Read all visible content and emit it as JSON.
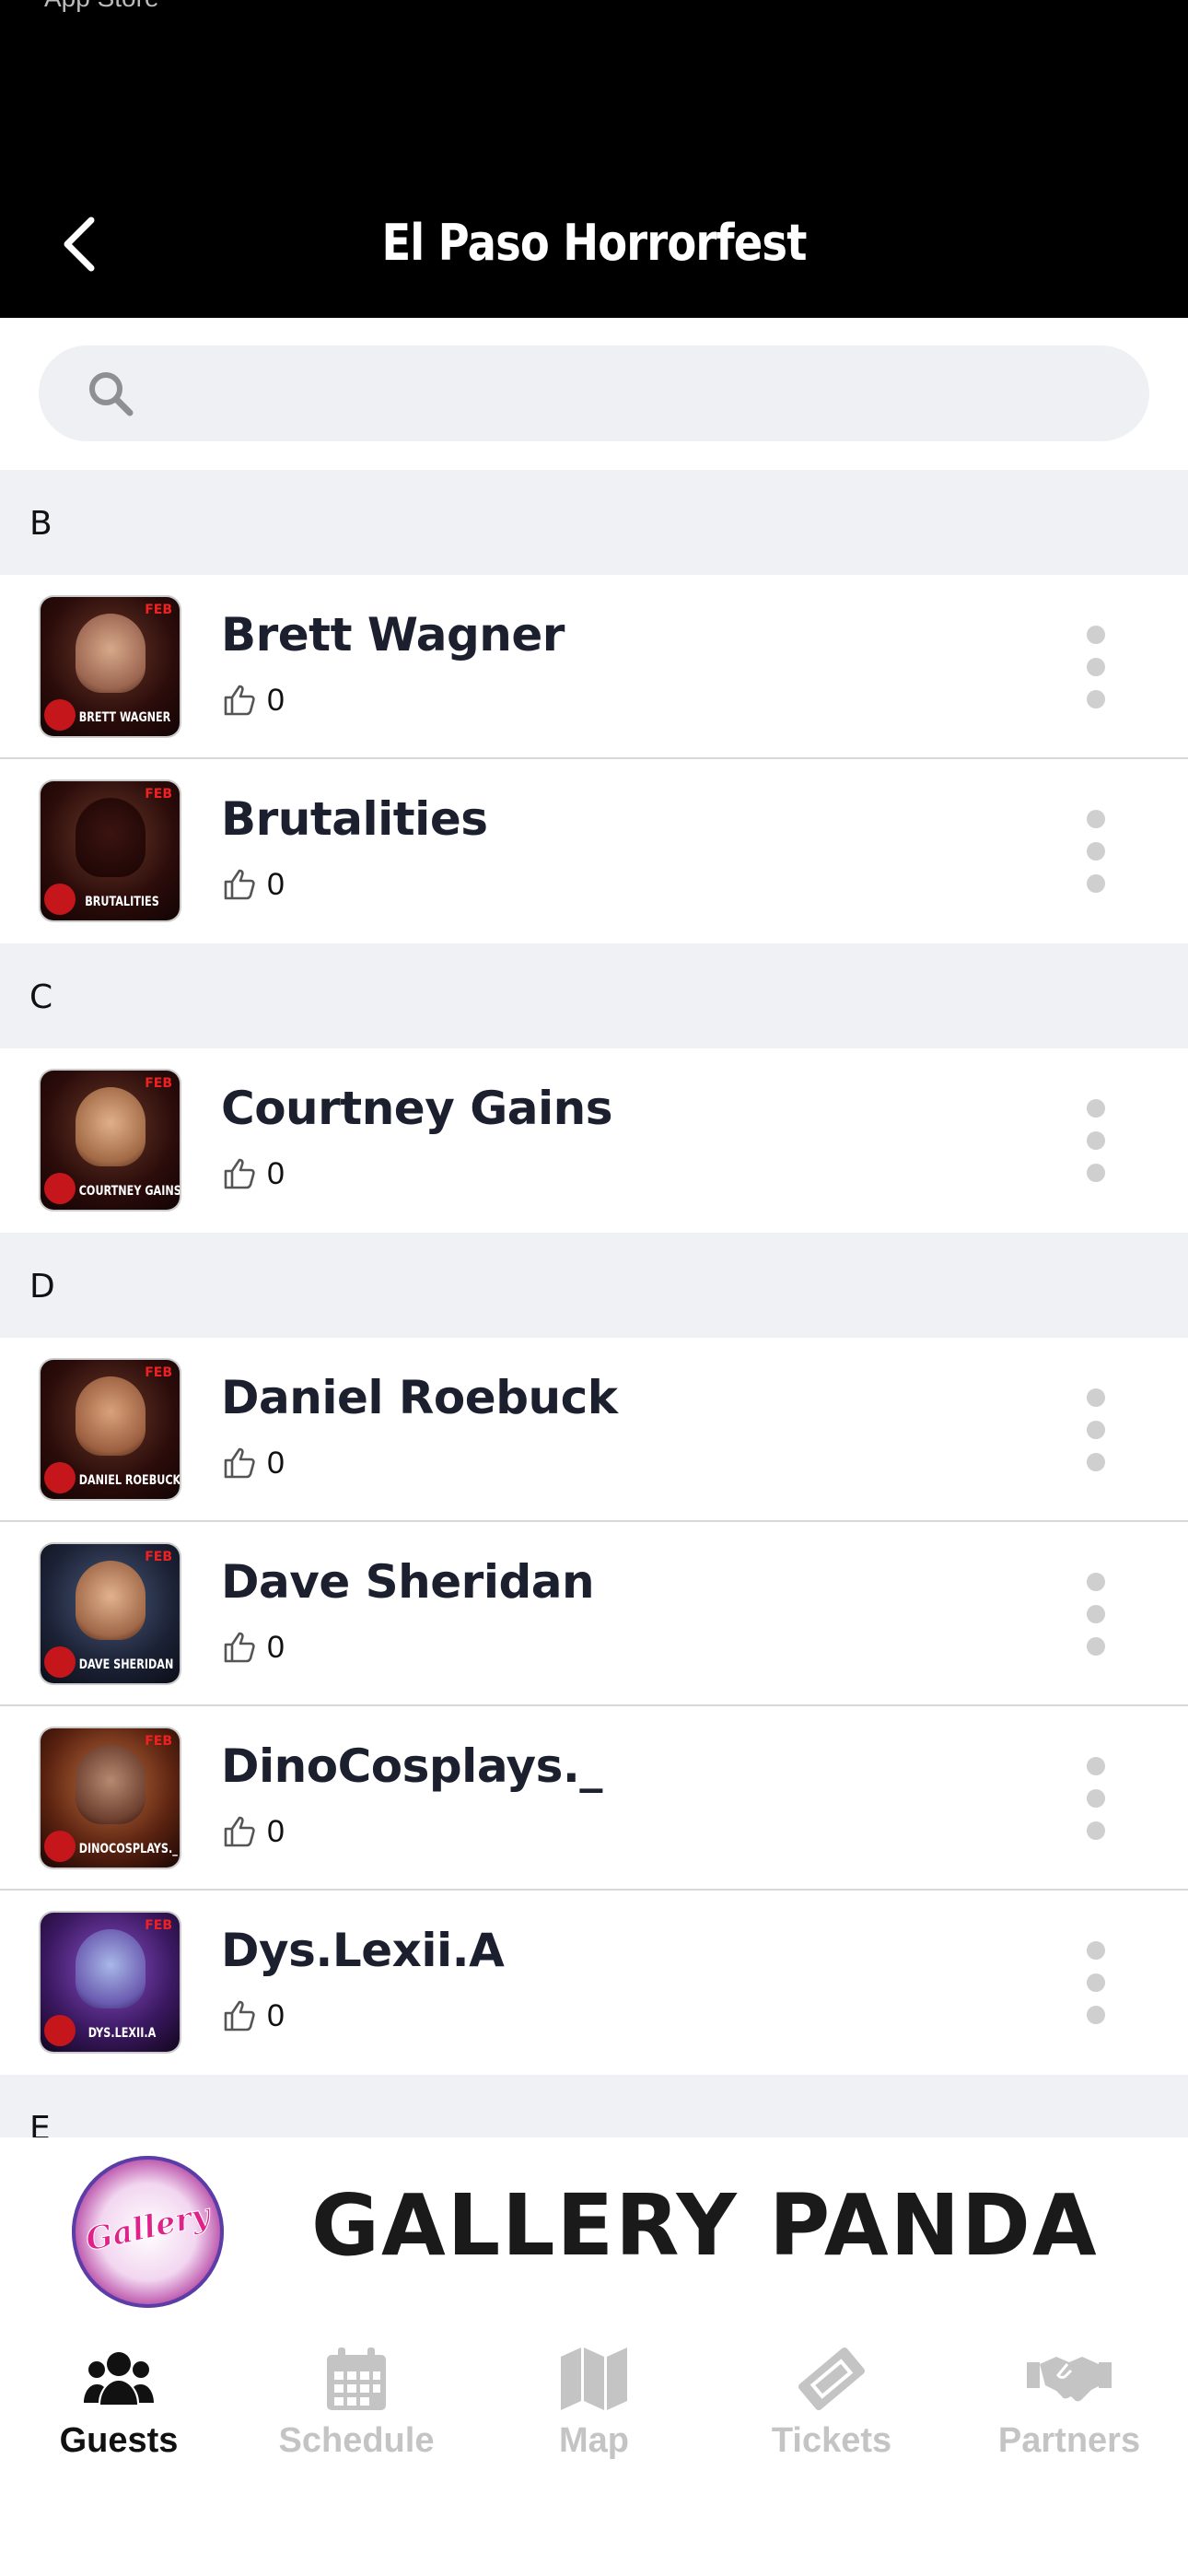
{
  "status_bar": {
    "text": "App Store"
  },
  "nav": {
    "title": "El Paso Horrorfest"
  },
  "search": {
    "placeholder": ""
  },
  "sections": [
    {
      "letter": "B",
      "guests": [
        {
          "name": "Brett Wagner",
          "likes": "0",
          "caption": "BRETT WAGNER"
        },
        {
          "name": "Brutalities",
          "likes": "0",
          "caption": "BRUTALITIES"
        }
      ]
    },
    {
      "letter": "C",
      "guests": [
        {
          "name": "Courtney Gains",
          "likes": "0",
          "caption": "COURTNEY GAINS"
        }
      ]
    },
    {
      "letter": "D",
      "guests": [
        {
          "name": "Daniel Roebuck",
          "likes": "0",
          "caption": "DANIEL ROEBUCK"
        },
        {
          "name": "Dave Sheridan",
          "likes": "0",
          "caption": "DAVE SHERIDAN"
        },
        {
          "name": "DinoCosplays._",
          "likes": "0",
          "caption": "DINOCOSPLAYS._"
        },
        {
          "name": "Dys.Lexii.A",
          "likes": "0",
          "caption": "DYS.LEXII.A"
        }
      ]
    },
    {
      "letter": "E",
      "guests": []
    }
  ],
  "thumb_badge": "FEB",
  "banner": {
    "title": "GALLERY PANDA",
    "logo_text": "Gallery"
  },
  "tabs": [
    {
      "label": "Guests",
      "icon": "users-icon",
      "active": true
    },
    {
      "label": "Schedule",
      "icon": "calendar-icon",
      "active": false
    },
    {
      "label": "Map",
      "icon": "map-icon",
      "active": false
    },
    {
      "label": "Tickets",
      "icon": "ticket-icon",
      "active": false
    },
    {
      "label": "Partners",
      "icon": "handshake-icon",
      "active": false
    }
  ],
  "colors": {
    "header_bg": "#000000",
    "section_bg": "#eff1f4",
    "text_dark": "#1b1f2e",
    "tab_inactive": "#c4c4c4"
  }
}
